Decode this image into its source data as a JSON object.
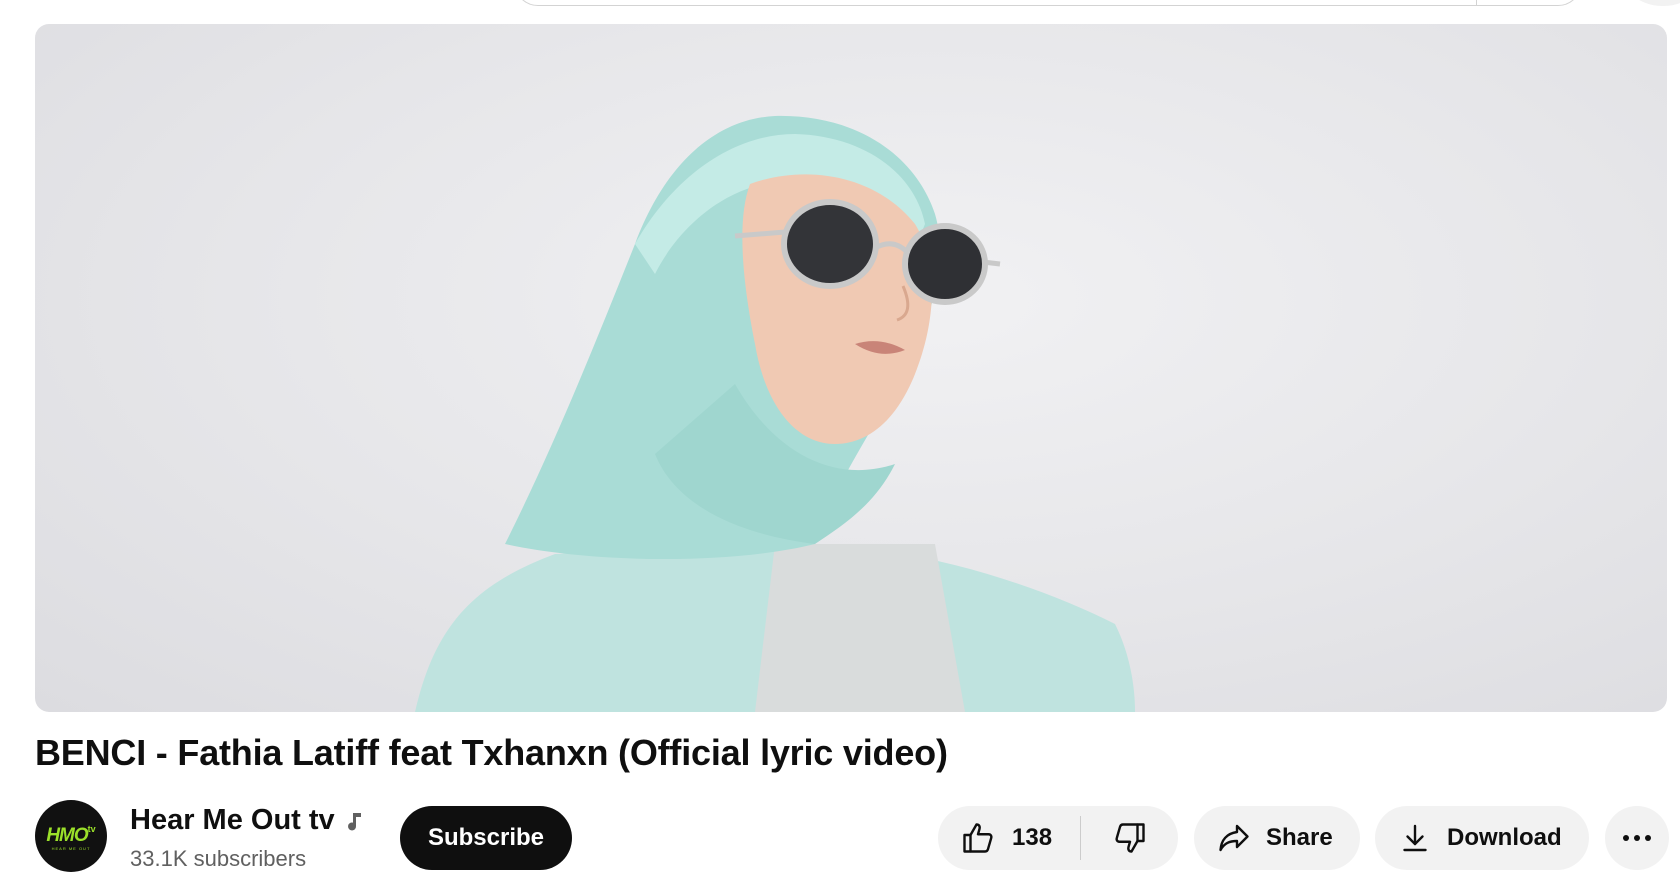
{
  "video": {
    "title": "BENCI - Fathia Latiff feat Txhanxn (Official lyric video)"
  },
  "channel": {
    "name": "Hear Me Out tv",
    "subscribers": "33.1K subscribers",
    "avatar_text": "HMO",
    "avatar_tv": "tv",
    "avatar_subtext": "HEAR ME OUT"
  },
  "actions": {
    "subscribe_label": "Subscribe",
    "like_count": "138",
    "share_label": "Share",
    "download_label": "Download"
  },
  "icons": {
    "like": "thumbs-up-icon",
    "dislike": "thumbs-down-icon",
    "share": "share-arrow-icon",
    "download": "download-icon",
    "more": "more-horizontal-icon",
    "music": "music-note-icon"
  },
  "colors": {
    "subscribe_bg": "#0f0f0f",
    "pill_bg": "#f2f2f2",
    "secondary_text": "#606060",
    "logo_green": "#9be02a"
  }
}
